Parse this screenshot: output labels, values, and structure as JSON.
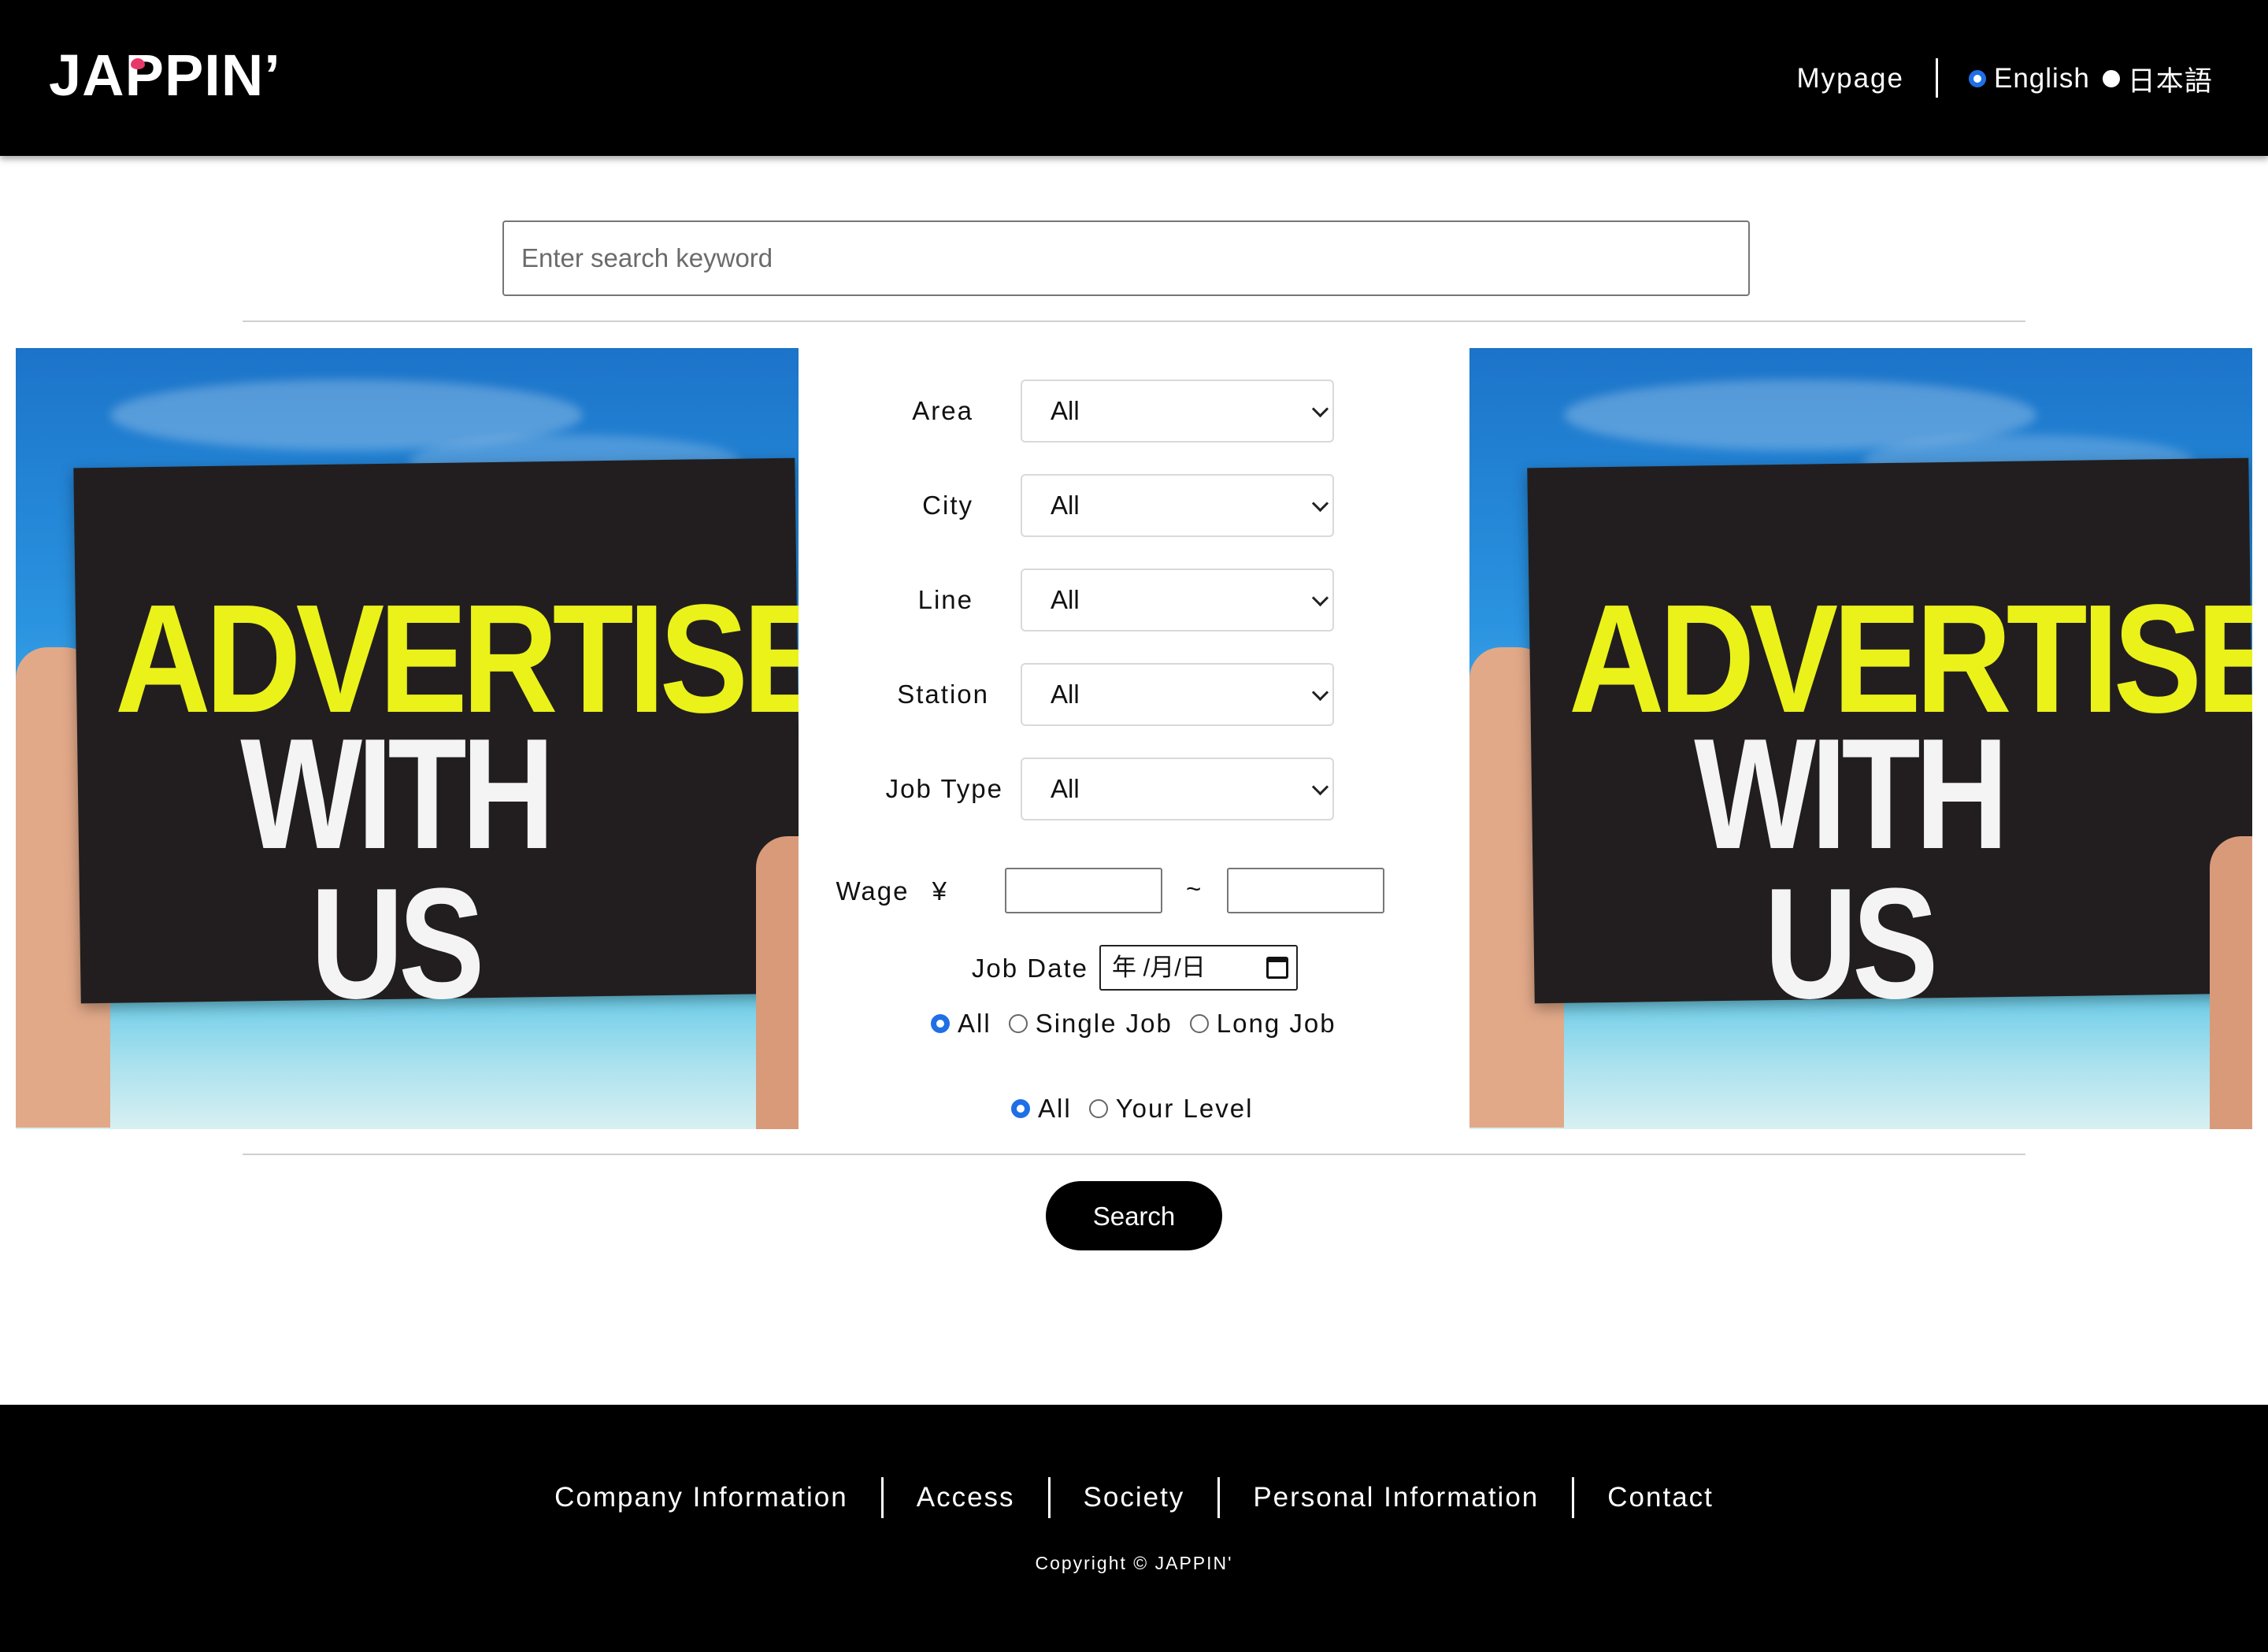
{
  "header": {
    "logo_text": "JAPPIN’",
    "mypage_label": "Mypage",
    "languages": [
      {
        "label": "English",
        "selected": true
      },
      {
        "label": "日本語",
        "selected": false
      }
    ]
  },
  "search": {
    "placeholder": "Enter search keyword",
    "value": ""
  },
  "ads": {
    "line1": "ADVERTISE",
    "line2": "WITH US"
  },
  "filters": {
    "area": {
      "label": "Area",
      "value": "All"
    },
    "city": {
      "label": "City",
      "value": "All"
    },
    "line": {
      "label": "Line",
      "value": "All"
    },
    "station": {
      "label": "Station",
      "value": "All"
    },
    "job_type": {
      "label": "Job Type",
      "value": "All"
    },
    "wage": {
      "label": "Wage",
      "currency": "¥",
      "separator": "~",
      "min": "",
      "max": ""
    },
    "job_date": {
      "label": "Job Date",
      "value": "年 /月/日"
    },
    "job_length": {
      "options": [
        {
          "label": "All",
          "selected": true
        },
        {
          "label": "Single Job",
          "selected": false
        },
        {
          "label": "Long Job",
          "selected": false
        }
      ]
    },
    "level": {
      "options": [
        {
          "label": "All",
          "selected": true
        },
        {
          "label": "Your Level",
          "selected": false
        }
      ]
    }
  },
  "search_button_label": "Search",
  "footer": {
    "links": [
      "Company Information",
      "Access",
      "Society",
      "Personal Information",
      "Contact"
    ],
    "copyright": "Copyright © JAPPIN'"
  },
  "colors": {
    "header_bg": "#000000",
    "accent_radio": "#1f6fe6",
    "ad_headline": "#eaf21a",
    "logo_mark": "#e8386a"
  }
}
